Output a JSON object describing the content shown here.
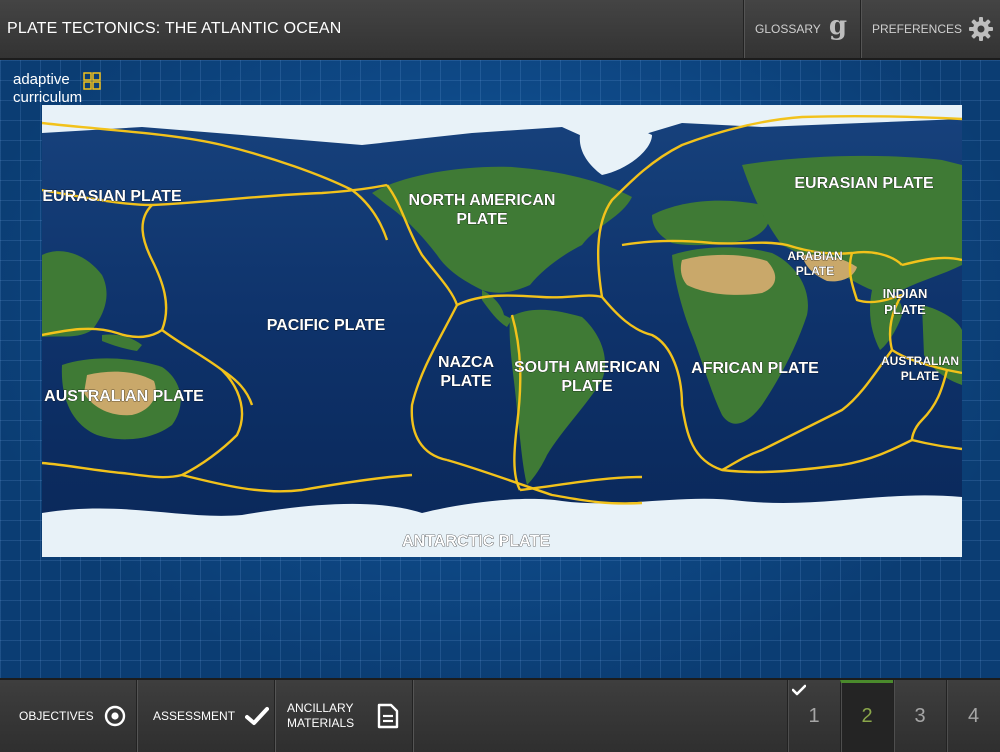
{
  "header": {
    "title": "PLATE TECTONICS: THE ATLANTIC OCEAN",
    "glossary_label": "GLOSSARY",
    "glossary_glyph": "g",
    "preferences_label": "PREFERENCES"
  },
  "brand": {
    "line1": "adaptive",
    "line2": "curriculum"
  },
  "map": {
    "plates": [
      {
        "id": "eurasian-west",
        "label": "EURASIAN PLATE"
      },
      {
        "id": "north-american",
        "label": "NORTH AMERICAN\nPLATE"
      },
      {
        "id": "eurasian-east",
        "label": "EURASIAN PLATE"
      },
      {
        "id": "arabian",
        "label": "ARABIAN\nPLATE"
      },
      {
        "id": "indian",
        "label": "INDIAN\nPLATE"
      },
      {
        "id": "pacific",
        "label": "PACIFIC PLATE"
      },
      {
        "id": "nazca",
        "label": "NAZCA\nPLATE"
      },
      {
        "id": "south-american",
        "label": "SOUTH AMERICAN\nPLATE"
      },
      {
        "id": "african",
        "label": "AFRICAN PLATE"
      },
      {
        "id": "australian-east",
        "label": "AUSTRALIAN\nPLATE"
      },
      {
        "id": "australian-west",
        "label": "AUSTRALIAN PLATE"
      },
      {
        "id": "antarctic",
        "label": "ANTARCTIC PLATE"
      }
    ],
    "colors": {
      "ocean": "#0d2f66",
      "land": "#3f7a35",
      "desert": "#c9a86a",
      "ice": "#e8f2f8",
      "boundary": "#f2c21b"
    }
  },
  "footer": {
    "objectives_label": "OBJECTIVES",
    "assessment_label": "ASSESSMENT",
    "ancillary_label": "ANCILLARY\nMATERIALS",
    "pages": [
      {
        "number": "1",
        "completed": true
      },
      {
        "number": "2",
        "active": true
      },
      {
        "number": "3"
      },
      {
        "number": "4"
      }
    ]
  }
}
